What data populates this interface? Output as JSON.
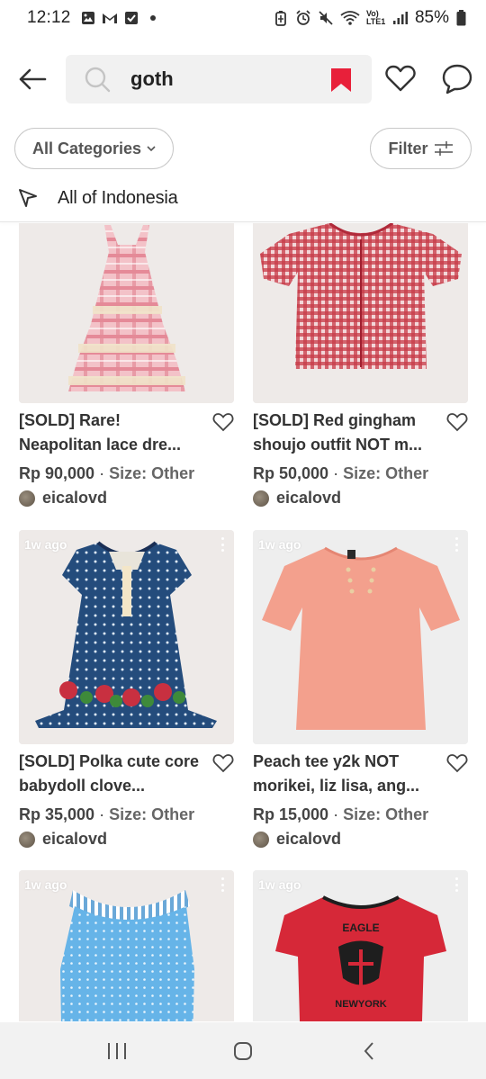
{
  "status_bar": {
    "time": "12:12",
    "network": "Vo) LTE1",
    "battery": "85%"
  },
  "search": {
    "query": "goth",
    "accent_color": "#e8203a"
  },
  "filters": {
    "categories_label": "All Categories",
    "filter_label": "Filter"
  },
  "location": {
    "label": "All of Indonesia"
  },
  "listings": [
    {
      "title": "[SOLD] Rare! Neapolitan lace dre...",
      "price": "Rp 90,000",
      "size": "Size: Other",
      "seller": "eicalovd",
      "age": ""
    },
    {
      "title": "[SOLD] Red gingham shoujo outfit NOT m...",
      "price": "Rp 50,000",
      "size": "Size: Other",
      "seller": "eicalovd",
      "age": ""
    },
    {
      "title": "[SOLD] Polka cute core babydoll clove...",
      "price": "Rp 35,000",
      "size": "Size: Other",
      "seller": "eicalovd",
      "age": "1w ago"
    },
    {
      "title": "Peach tee y2k NOT morikei, liz lisa, ang...",
      "price": "Rp 15,000",
      "size": "Size: Other",
      "seller": "eicalovd",
      "age": "1w ago"
    },
    {
      "title": "",
      "price": "",
      "size": "",
      "seller": "",
      "age": "1w ago"
    },
    {
      "title": "",
      "price": "",
      "size": "",
      "seller": "",
      "age": "1w ago",
      "print_text_top": "EAGLE",
      "print_text_bottom": "NEWYORK"
    }
  ],
  "separator": " · "
}
